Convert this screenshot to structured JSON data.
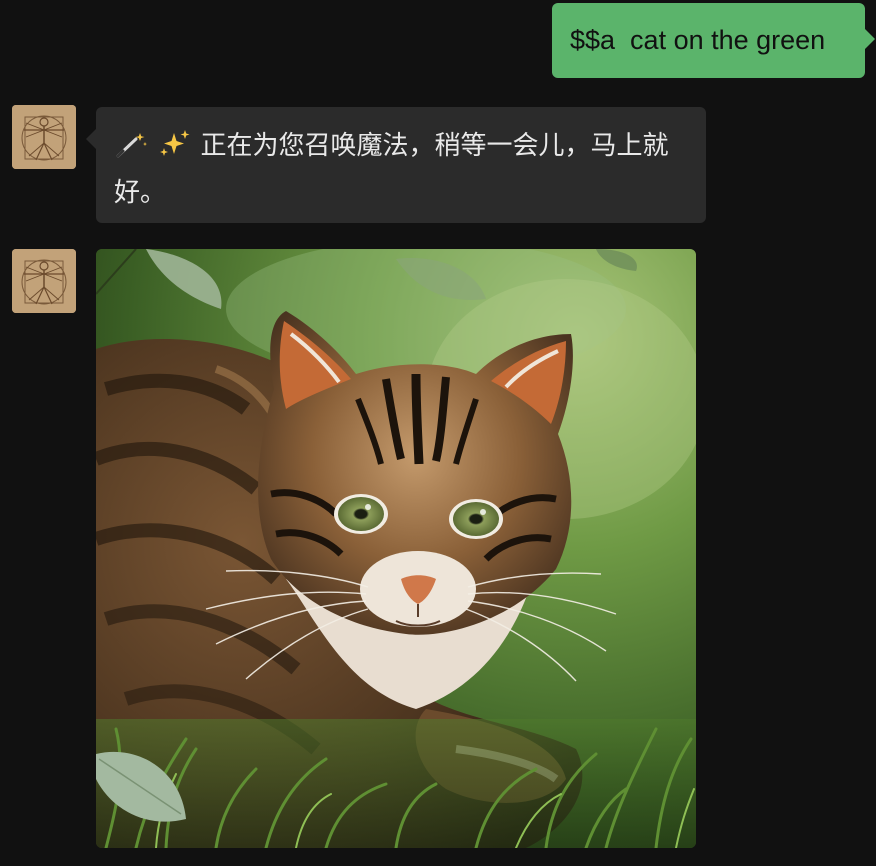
{
  "messages": [
    {
      "direction": "outgoing",
      "type": "text",
      "text": "$$a  cat on the green",
      "bubble_color": "#5bb46b"
    },
    {
      "direction": "incoming",
      "type": "text",
      "icons": [
        "magic-wand-icon",
        "sparkles-icon"
      ],
      "text": "正在为您召唤魔法，稍等一会儿，马上就好。",
      "bubble_color": "#2b2b2b"
    },
    {
      "direction": "incoming",
      "type": "image",
      "image_subject": "tabby cat lying on green grass"
    }
  ],
  "colors": {
    "background": "#111111",
    "outgoing_bubble": "#5bb46b",
    "incoming_bubble": "#2b2b2b",
    "incoming_text": "#e9e9e9"
  }
}
